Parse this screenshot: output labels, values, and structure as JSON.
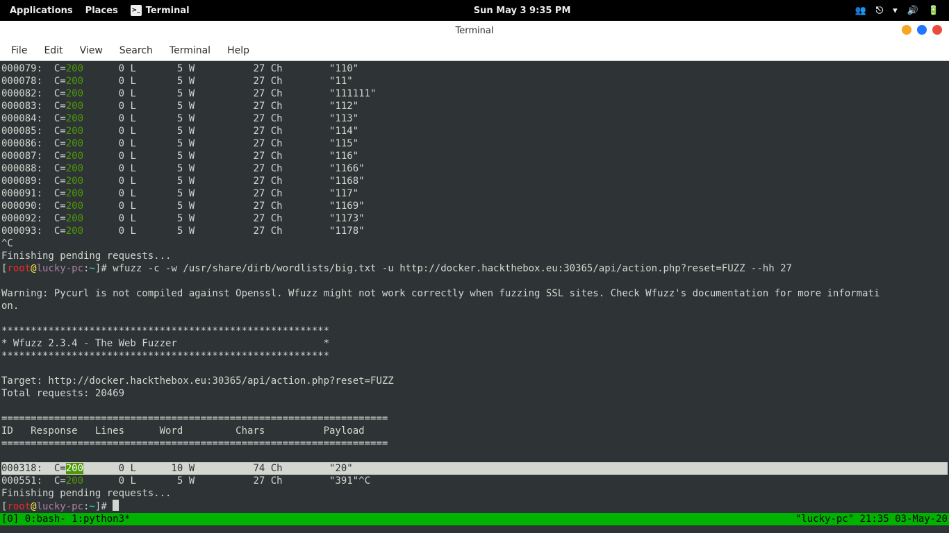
{
  "topbar": {
    "applications": "Applications",
    "places": "Places",
    "terminal": "Terminal",
    "datetime": "Sun May 3  9:35 PM"
  },
  "titlebar": {
    "title": "Terminal"
  },
  "menubar": {
    "file": "File",
    "edit": "Edit",
    "view": "View",
    "search": "Search",
    "terminal": "Terminal",
    "help": "Help"
  },
  "rows_top": [
    {
      "id": "000079",
      "code": "200",
      "l": "0",
      "w": "5",
      "ch": "27",
      "payload": "\"110\""
    },
    {
      "id": "000078",
      "code": "200",
      "l": "0",
      "w": "5",
      "ch": "27",
      "payload": "\"11\""
    },
    {
      "id": "000082",
      "code": "200",
      "l": "0",
      "w": "5",
      "ch": "27",
      "payload": "\"111111\""
    },
    {
      "id": "000083",
      "code": "200",
      "l": "0",
      "w": "5",
      "ch": "27",
      "payload": "\"112\""
    },
    {
      "id": "000084",
      "code": "200",
      "l": "0",
      "w": "5",
      "ch": "27",
      "payload": "\"113\""
    },
    {
      "id": "000085",
      "code": "200",
      "l": "0",
      "w": "5",
      "ch": "27",
      "payload": "\"114\""
    },
    {
      "id": "000086",
      "code": "200",
      "l": "0",
      "w": "5",
      "ch": "27",
      "payload": "\"115\""
    },
    {
      "id": "000087",
      "code": "200",
      "l": "0",
      "w": "5",
      "ch": "27",
      "payload": "\"116\""
    },
    {
      "id": "000088",
      "code": "200",
      "l": "0",
      "w": "5",
      "ch": "27",
      "payload": "\"1166\""
    },
    {
      "id": "000089",
      "code": "200",
      "l": "0",
      "w": "5",
      "ch": "27",
      "payload": "\"1168\""
    },
    {
      "id": "000091",
      "code": "200",
      "l": "0",
      "w": "5",
      "ch": "27",
      "payload": "\"117\""
    },
    {
      "id": "000090",
      "code": "200",
      "l": "0",
      "w": "5",
      "ch": "27",
      "payload": "\"1169\""
    },
    {
      "id": "000092",
      "code": "200",
      "l": "0",
      "w": "5",
      "ch": "27",
      "payload": "\"1173\""
    },
    {
      "id": "000093",
      "code": "200",
      "l": "0",
      "w": "5",
      "ch": "27",
      "payload": "\"1178\""
    }
  ],
  "lines": {
    "ctrl_c": "^C",
    "finishing": "Finishing pending requests...",
    "prompt_open": "[",
    "prompt_user": "root",
    "prompt_at": "@",
    "prompt_host": "lucky-pc",
    "prompt_colon": ":",
    "prompt_path": "~",
    "prompt_close": "]",
    "prompt_hash": "# ",
    "cmd": "wfuzz -c -w /usr/share/dirb/wordlists/big.txt -u http://docker.hackthebox.eu:30365/api/action.php?reset=FUZZ --hh 27",
    "warning": "Warning: Pycurl is not compiled against Openssl. Wfuzz might not work correctly when fuzzing SSL sites. Check Wfuzz's documentation for more informati\non.",
    "stars": "********************************************************",
    "banner": "* Wfuzz 2.3.4 - The Web Fuzzer                         *",
    "target": "Target: http://docker.hackthebox.eu:30365/api/action.php?reset=FUZZ",
    "total": "Total requests: 20469",
    "divider": "==================================================================",
    "header": "ID   Response   Lines      Word         Chars          Payload    "
  },
  "result_hl": {
    "id": "000318",
    "code": "200",
    "l": "0",
    "w": "10",
    "ch": "74",
    "payload": "\"20\""
  },
  "result_551": {
    "id": "000551",
    "code": "200",
    "l": "0",
    "w": "5",
    "ch": "27",
    "payload": "\"391\"^C"
  },
  "tmux": {
    "left": "[0] 0:bash- 1:python3*",
    "right": "\"lucky-pc\" 21:35 03-May-20"
  }
}
